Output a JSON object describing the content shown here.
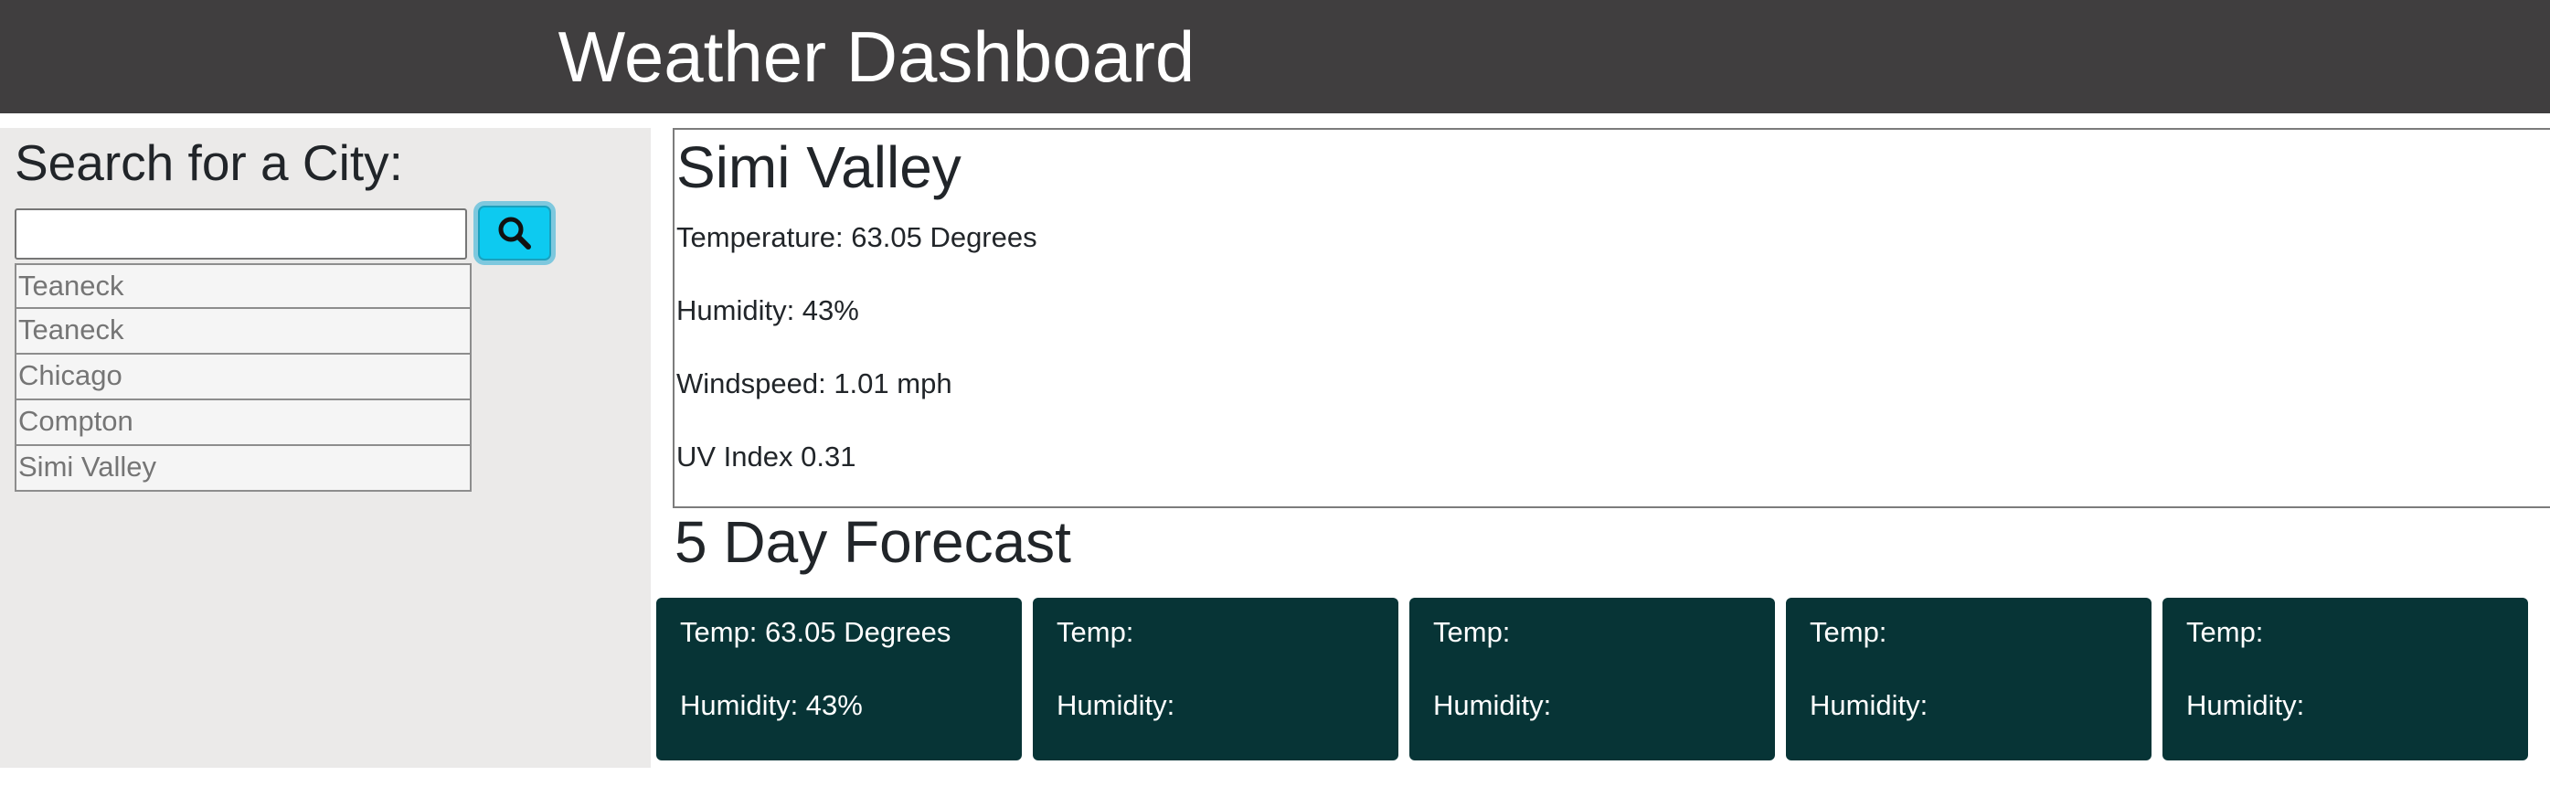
{
  "header": {
    "title": "Weather Dashboard"
  },
  "sidebar": {
    "heading": "Search for a City:",
    "search": {
      "value": "",
      "placeholder": ""
    },
    "search_button_icon": "search-icon",
    "history": [
      "Teaneck",
      "Teaneck",
      "Chicago",
      "Compton",
      "Simi Valley"
    ]
  },
  "current": {
    "city": "Simi Valley",
    "temperature": "Temperature: 63.05 Degrees",
    "humidity": "Humidity: 43%",
    "windspeed": "Windspeed: 1.01 mph",
    "uv_index": "UV Index 0.31"
  },
  "forecast": {
    "title": "5 Day Forecast",
    "cards": [
      {
        "temp": "Temp: 63.05 Degrees",
        "humidity": "Humidity: 43%"
      },
      {
        "temp": "Temp:",
        "humidity": "Humidity:"
      },
      {
        "temp": "Temp:",
        "humidity": "Humidity:"
      },
      {
        "temp": "Temp:",
        "humidity": "Humidity:"
      },
      {
        "temp": "Temp:",
        "humidity": "Humidity:"
      }
    ]
  },
  "colors": {
    "header_bg": "#403e3f",
    "sidebar_bg": "#ebeae9",
    "search_button": "#0dcaf0",
    "forecast_card_bg": "#073436"
  }
}
